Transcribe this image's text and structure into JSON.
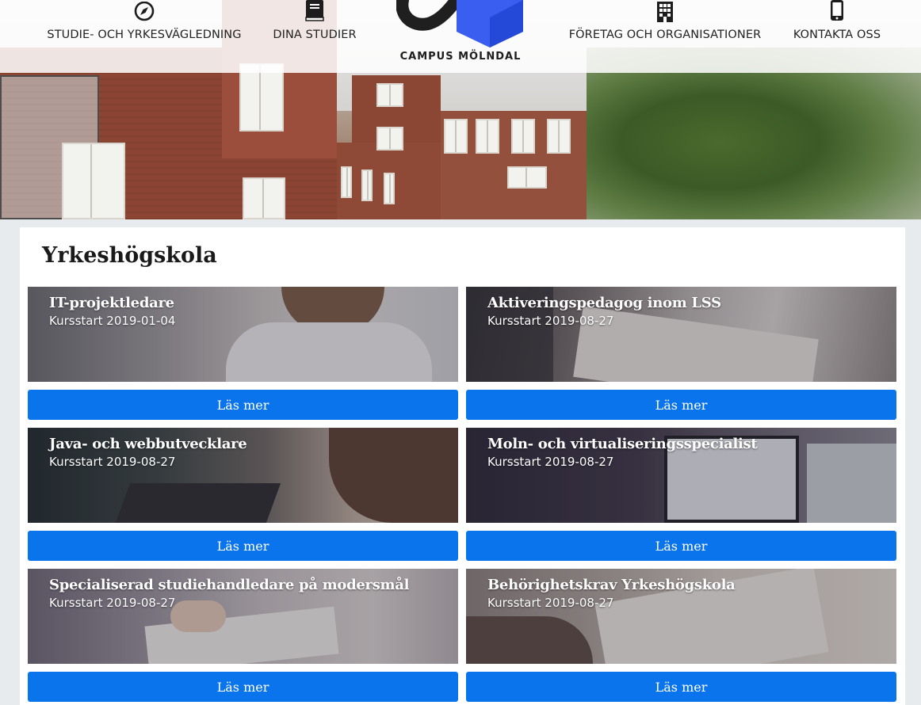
{
  "nav": {
    "items": [
      {
        "label": "STUDIE- OCH YRKESVÄGLEDNING",
        "icon": "compass-icon"
      },
      {
        "label": "DINA STUDIER",
        "icon": "book-icon"
      },
      {
        "label": "FÖRETAG OCH ORGANISATIONER",
        "icon": "building-icon"
      },
      {
        "label": "KONTAKTA OSS",
        "icon": "mobile-phone-icon"
      }
    ],
    "logo_text": "CAMPUS MÖLNDAL"
  },
  "section": {
    "title": "Yrkeshögskola"
  },
  "courses": [
    {
      "title": "IT-projektledare",
      "start": "Kursstart 2019-01-04",
      "button": "Läs mer"
    },
    {
      "title": "Aktiveringspedagog inom LSS",
      "start": "Kursstart 2019-08-27",
      "button": "Läs mer"
    },
    {
      "title": "Java- och webbutvecklare",
      "start": "Kursstart 2019-08-27",
      "button": "Läs mer"
    },
    {
      "title": "Moln- och virtualiseringsspecialist",
      "start": "Kursstart 2019-08-27",
      "button": "Läs mer"
    },
    {
      "title": "Specialiserad studiehandledare på modersmål",
      "start": "Kursstart 2019-08-27",
      "button": "Läs mer"
    },
    {
      "title": "Behörighetskrav Yrkeshögskola",
      "start": "Kursstart 2019-08-27",
      "button": "Läs mer"
    }
  ],
  "colors": {
    "button": "#0a74ec",
    "logo_blue": "#3a5ef0",
    "logo_dark": "#1f1f1f"
  }
}
